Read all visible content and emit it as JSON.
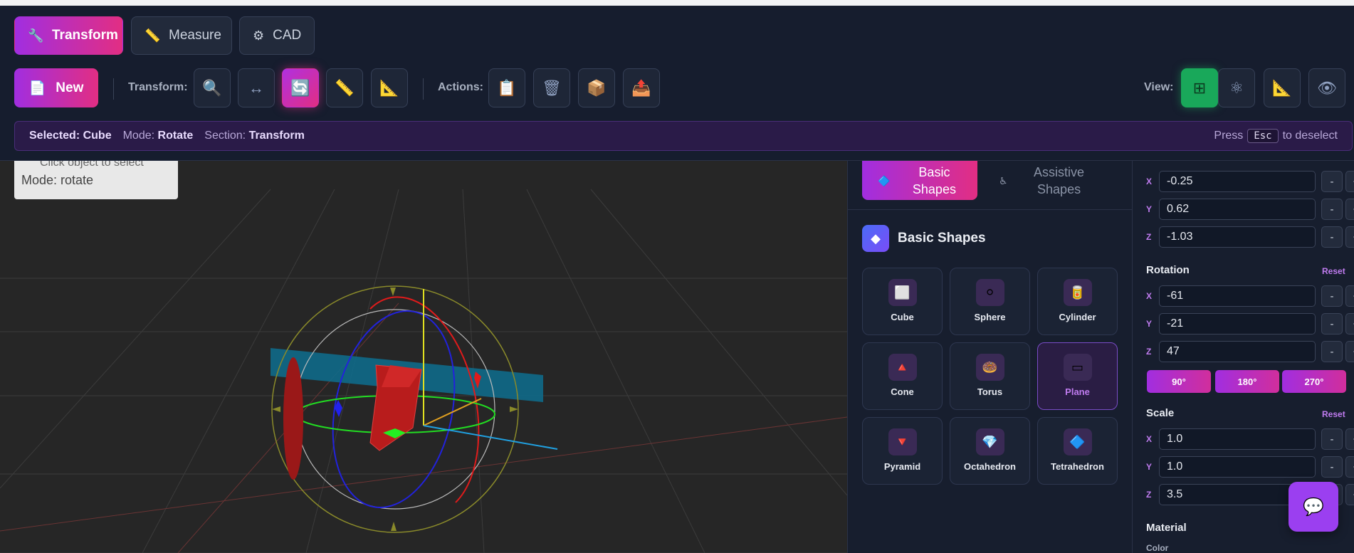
{
  "tabs": [
    {
      "label": "Transform",
      "icon": "wrench-icon",
      "glyph": "🔧",
      "active": true
    },
    {
      "label": "Measure",
      "icon": "ruler-icon",
      "glyph": "📏",
      "active": false
    },
    {
      "label": "CAD",
      "icon": "gear-icon",
      "glyph": "⚙",
      "active": false
    }
  ],
  "toolbar": {
    "new_label": "New",
    "new_glyph": "📄",
    "transform_label": "Transform:",
    "actions_label": "Actions:",
    "view_label": "View:",
    "transform_tools": [
      {
        "icon": "zoom-icon",
        "glyph": "🔍"
      },
      {
        "icon": "move-icon",
        "glyph": "↔"
      },
      {
        "icon": "rotate-icon",
        "glyph": "🔄",
        "active": true
      },
      {
        "icon": "ruler-icon",
        "glyph": "📏"
      },
      {
        "icon": "set-square-icon",
        "glyph": "📐"
      }
    ],
    "action_tools": [
      {
        "icon": "clipboard-icon",
        "glyph": "📋"
      },
      {
        "icon": "trash-icon",
        "glyph": "🗑"
      },
      {
        "icon": "package-icon",
        "glyph": "📦"
      },
      {
        "icon": "export-icon",
        "glyph": "📤"
      }
    ],
    "view_tools": [
      {
        "icon": "grid-icon",
        "glyph": "⊞",
        "active": true
      },
      {
        "icon": "wireframe-icon",
        "glyph": "⚛"
      },
      {
        "icon": "set-square-icon",
        "glyph": "📐"
      },
      {
        "icon": "eye-icon",
        "glyph": "👁"
      }
    ]
  },
  "status": {
    "selected_label": "Selected:",
    "selected_value": "Cube",
    "mode_label": "Mode:",
    "mode_value": "Rotate",
    "section_label": "Section:",
    "section_value": "Transform",
    "press": "Press",
    "key": "Esc",
    "deselect": "to deselect"
  },
  "viewport": {
    "info_partial": "Click object to select",
    "mode_text": "Mode: rotate"
  },
  "shape_panel": {
    "tabs": [
      {
        "label": "Basic Shapes",
        "glyph": "🔷",
        "active": true
      },
      {
        "label": "Assistive Shapes",
        "glyph": "♿",
        "active": false
      }
    ],
    "section_title": "Basic Shapes",
    "section_glyph": "◆",
    "shapes": [
      {
        "label": "Cube",
        "icon": "cube-icon",
        "glyph": "⬜"
      },
      {
        "label": "Sphere",
        "icon": "sphere-icon",
        "glyph": "⚪"
      },
      {
        "label": "Cylinder",
        "icon": "cylinder-icon",
        "glyph": "🥫"
      },
      {
        "label": "Cone",
        "icon": "cone-icon",
        "glyph": "🔺"
      },
      {
        "label": "Torus",
        "icon": "torus-icon",
        "glyph": "🍩"
      },
      {
        "label": "Plane",
        "icon": "plane-icon",
        "glyph": "▭",
        "active": true
      },
      {
        "label": "Pyramid",
        "icon": "pyramid-icon",
        "glyph": "🔻"
      },
      {
        "label": "Octahedron",
        "icon": "octahedron-icon",
        "glyph": "💎"
      },
      {
        "label": "Tetrahedron",
        "icon": "tetrahedron-icon",
        "glyph": "🔷"
      }
    ]
  },
  "properties": {
    "position": {
      "x": "-0.25",
      "y": "0.62",
      "z": "-1.03"
    },
    "rotation_label": "Rotation",
    "rotation": {
      "x": "-61",
      "y": "-21",
      "z": "47"
    },
    "quick_rotations": [
      "90°",
      "180°",
      "270°"
    ],
    "scale_label": "Scale",
    "scale": {
      "x": "1.0",
      "y": "1.0",
      "z": "3.5"
    },
    "reset_label": "Reset",
    "material_label": "Material",
    "color_label": "Color",
    "axes": [
      "X",
      "Y",
      "Z"
    ],
    "minus": "-",
    "plus": "+"
  },
  "chat": {
    "icon": "chat-icon",
    "glyph": "💬"
  },
  "colors": {
    "accent_gradient_start": "#a12ee0",
    "accent_gradient_end": "#e22e83",
    "view_active": "#19a85a",
    "header_bg": "#161d2e",
    "viewport_bg": "#262626",
    "cube_red": "#b81c1c",
    "plane_cyan": "#0f6a8a"
  }
}
